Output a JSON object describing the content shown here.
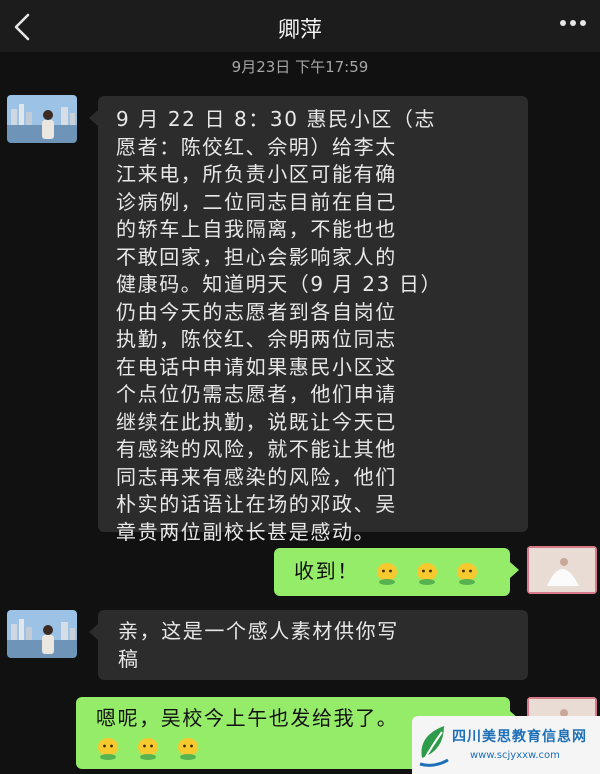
{
  "header": {
    "title": "卿萍",
    "back_icon": "chevron-left-icon",
    "more_icon": "more-dots-icon"
  },
  "chat": {
    "timestamp": "9月23日 下午17:59",
    "messages": [
      {
        "side": "left",
        "lines": [
          "9 月 22 日 8：30 惠民小区（志",
          "愿者：陈佼红、佘明）给李太",
          "江来电，所负责小区可能有确",
          "诊病例，二位同志目前在自己",
          "的轿车上自我隔离，不能也也",
          "不敢回家，担心会影响家人的",
          "健康码。知道明天（9 月 23 日）",
          "仍由今天的志愿者到各自岗位",
          "执勤，陈佼红、佘明两位同志",
          "在电话中申请如果惠民小区这",
          "个点位仍需志愿者，他们申请",
          "继续在此执勤，说既让今天已",
          "有感染的风险，就不能让其他",
          "同志再来有感染的风险，他们",
          "朴实的话语让在场的邓政、吴",
          "章贵两位副校长甚是感动。"
        ]
      },
      {
        "side": "right",
        "text": "收到！",
        "emoji_count": 3,
        "emoji_icon": "smiley-emoji-icon"
      },
      {
        "side": "left",
        "lines": [
          "亲，这是一个感人素材供你写",
          "稿"
        ]
      },
      {
        "side": "right",
        "lines": [
          "嗯呢，吴校今上午也发给我了。"
        ],
        "emoji_count": 3,
        "emoji_icon": "smiley-emoji-icon"
      }
    ]
  },
  "watermark": {
    "name": "四川美思教育信息网",
    "url": "www.scjyxxw.com",
    "logo": "leaf-logo"
  },
  "colors": {
    "bg": "#111111",
    "bubble_left": "#2c2c2c",
    "bubble_right": "#95ec69"
  }
}
